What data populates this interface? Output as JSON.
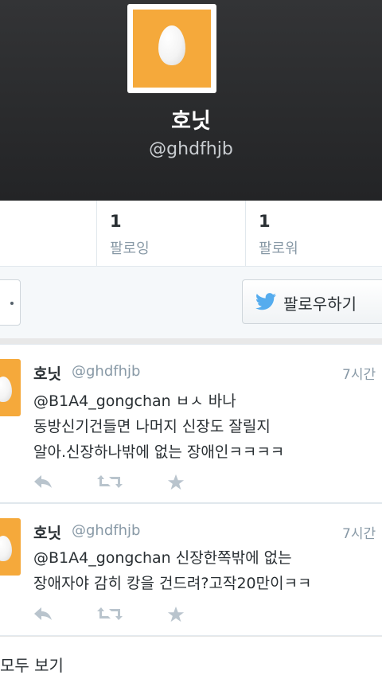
{
  "profile": {
    "display_name": "호닛",
    "handle": "@ghdfhjb"
  },
  "stats": {
    "following": {
      "count": "1",
      "label": "팔로잉"
    },
    "followers": {
      "count": "1",
      "label": "팔로워"
    }
  },
  "actions": {
    "follow_label": "팔로우하기"
  },
  "tweets": [
    {
      "name": "호닛",
      "handle": "@ghdfhjb",
      "time": "7시간",
      "lines": [
        "@B1A4_gongchan ㅂㅅ 바나",
        "동방신기건들면 나머지 신장도 잘릴지",
        "알아.신장하나밖에 없는 장애인ㅋㅋㅋㅋ"
      ]
    },
    {
      "name": "호닛",
      "handle": "@ghdfhjb",
      "time": "7시간",
      "lines": [
        "@B1A4_gongchan 신장한쪽밖에 없는",
        "장애자야 감히 캉을 건드려?고작20만이ㅋㅋ"
      ]
    }
  ],
  "footer": {
    "see_all_label": "모두 보기"
  },
  "colors": {
    "accent_blue": "#55acee",
    "egg_avatar_bg": "#f5a93b",
    "header_bg": "#2b2c2e",
    "muted_text": "#8899a6"
  },
  "icons": [
    "egg-avatar",
    "twitter-bird-icon",
    "reply-icon",
    "retweet-icon",
    "favorite-icon"
  ]
}
